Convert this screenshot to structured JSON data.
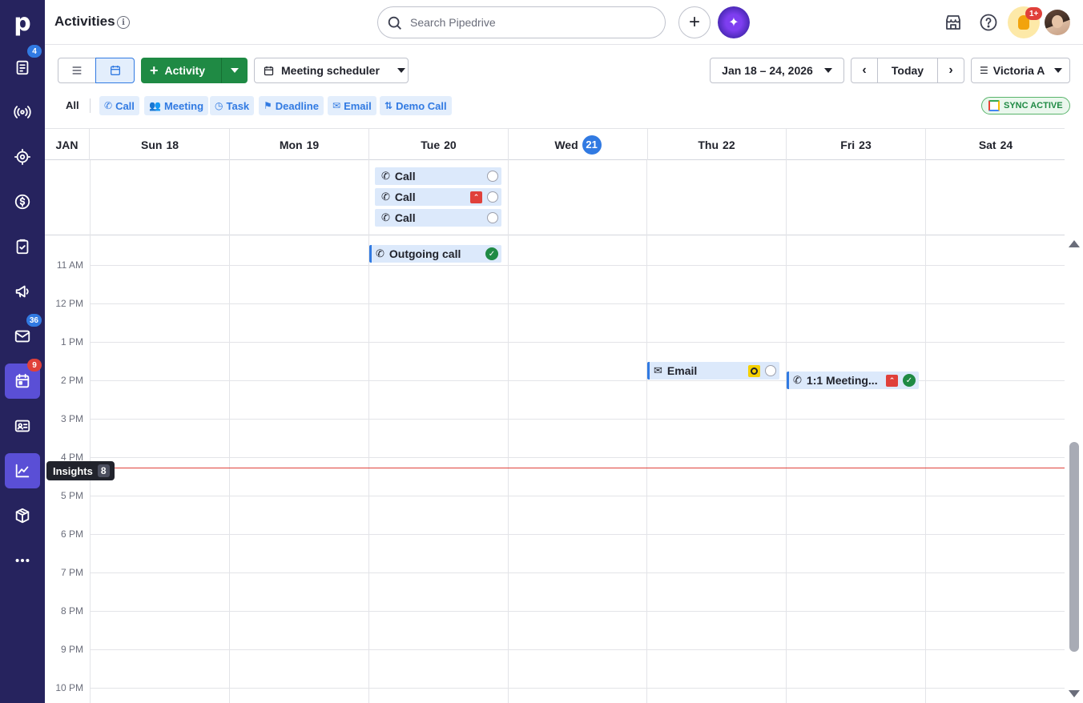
{
  "sidebar": {
    "logo": "p",
    "items": [
      {
        "name": "leads",
        "badge": "4"
      },
      {
        "name": "radar",
        "badge": ""
      },
      {
        "name": "target",
        "badge": ""
      },
      {
        "name": "deals",
        "badge": ""
      },
      {
        "name": "projects",
        "badge": ""
      },
      {
        "name": "campaigns",
        "badge": ""
      },
      {
        "name": "mail",
        "badge": "36"
      },
      {
        "name": "activities",
        "badge": "9"
      },
      {
        "name": "contacts",
        "badge": ""
      },
      {
        "name": "insights",
        "badge": ""
      },
      {
        "name": "products",
        "badge": ""
      },
      {
        "name": "more",
        "badge": ""
      }
    ],
    "tooltip": {
      "label": "Insights",
      "count": "8"
    }
  },
  "header": {
    "title": "Activities",
    "search_placeholder": "Search Pipedrive",
    "notification_badge": "1+"
  },
  "toolbar": {
    "add_activity_label": "Activity",
    "meeting_scheduler_label": "Meeting scheduler",
    "date_range": "Jan 18 – 24, 2026",
    "today_label": "Today",
    "user_filter": "Victoria A"
  },
  "filters": {
    "all_label": "All",
    "types": [
      "Call",
      "Meeting",
      "Task",
      "Deadline",
      "Email",
      "Demo Call"
    ],
    "sync_label": "SYNC ACTIVE"
  },
  "calendar": {
    "month": "JAN",
    "days": [
      {
        "name": "Sun",
        "num": "18",
        "today": false
      },
      {
        "name": "Mon",
        "num": "19",
        "today": false
      },
      {
        "name": "Tue",
        "num": "20",
        "today": false
      },
      {
        "name": "Wed",
        "num": "21",
        "today": true
      },
      {
        "name": "Thu",
        "num": "22",
        "today": false
      },
      {
        "name": "Fri",
        "num": "23",
        "today": false
      },
      {
        "name": "Sat",
        "num": "24",
        "today": false
      }
    ],
    "hours": [
      "11 AM",
      "12 PM",
      "1 PM",
      "2 PM",
      "3 PM",
      "4 PM",
      "5 PM",
      "6 PM",
      "7 PM",
      "8 PM",
      "9 PM",
      "10 PM"
    ],
    "all_day_events": [
      {
        "label": "Call",
        "priority": "",
        "status": "open"
      },
      {
        "label": "Call",
        "priority": "high",
        "status": "open"
      },
      {
        "label": "Call",
        "priority": "",
        "status": "open"
      }
    ],
    "timed_events": [
      {
        "label": "Outgoing call",
        "day": "Tue 20",
        "priority": "",
        "status": "done"
      },
      {
        "label": "Email",
        "day": "Thu 22",
        "priority": "medium",
        "status": "open"
      },
      {
        "label": "1:1 Meeting...",
        "day": "Fri 23",
        "priority": "high",
        "status": "done"
      }
    ]
  },
  "colors": {
    "sidebar": "#26235e",
    "accent": "#317ae2",
    "primary_green": "#1f8a44",
    "now_line": "#e0403a"
  }
}
